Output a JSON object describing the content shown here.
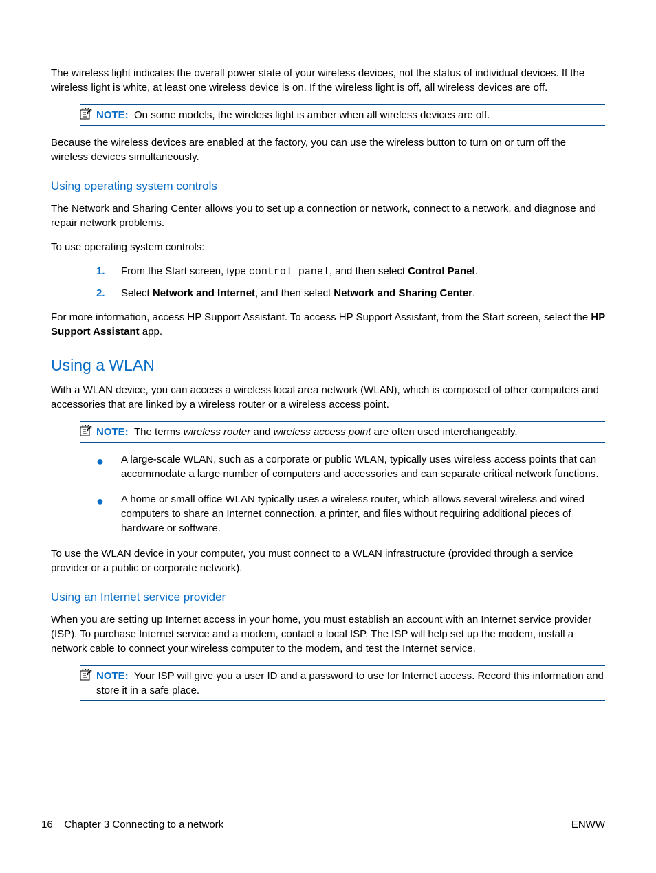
{
  "intro": {
    "para1": "The wireless light indicates the overall power state of your wireless devices, not the status of individual devices. If the wireless light is white, at least one wireless device is on. If the wireless light is off, all wireless devices are off."
  },
  "notes": {
    "label": "NOTE:",
    "note1": "On some models, the wireless light is amber when all wireless devices are off.",
    "note2_pre": "The terms ",
    "note2_i1": "wireless router",
    "note2_mid": " and ",
    "note2_i2": "wireless access point",
    "note2_post": " are often used interchangeably.",
    "note3": "Your ISP will give you a user ID and a password to use for Internet access. Record this information and store it in a safe place."
  },
  "after_note1": "Because the wireless devices are enabled at the factory, you can use the wireless button to turn on or turn off the wireless devices simultaneously.",
  "h3_os": "Using operating system controls",
  "os": {
    "p1": "The Network and Sharing Center allows you to set up a connection or network, connect to a network, and diagnose and repair network problems.",
    "p2": "To use operating system controls:",
    "step1_pre": "From the Start screen, type ",
    "step1_mono": "control panel",
    "step1_mid": ", and then select ",
    "step1_bold": "Control Panel",
    "step1_post": ".",
    "step2_pre": "Select ",
    "step2_b1": "Network and Internet",
    "step2_mid": ", and then select ",
    "step2_b2": "Network and Sharing Center",
    "step2_post": ".",
    "p3_pre": "For more information, access HP Support Assistant. To access HP Support Assistant, from the Start screen, select the ",
    "p3_bold": "HP Support Assistant",
    "p3_post": " app."
  },
  "h2_wlan": "Using a WLAN",
  "wlan": {
    "p1": "With a WLAN device, you can access a wireless local area network (WLAN), which is composed of other computers and accessories that are linked by a wireless router or a wireless access point.",
    "b1": "A large-scale WLAN, such as a corporate or public WLAN, typically uses wireless access points that can accommodate a large number of computers and accessories and can separate critical network functions.",
    "b2": "A home or small office WLAN typically uses a wireless router, which allows several wireless and wired computers to share an Internet connection, a printer, and files without requiring additional pieces of hardware or software.",
    "p2": "To use the WLAN device in your computer, you must connect to a WLAN infrastructure (provided through a service provider or a public or corporate network)."
  },
  "h3_isp": "Using an Internet service provider",
  "isp": {
    "p1": "When you are setting up Internet access in your home, you must establish an account with an Internet service provider (ISP). To purchase Internet service and a modem, contact a local ISP. The ISP will help set up the modem, install a network cable to connect your wireless computer to the modem, and test the Internet service."
  },
  "steps_nums": {
    "n1": "1.",
    "n2": "2."
  },
  "footer": {
    "page": "16",
    "chapter": "Chapter 3   Connecting to a network",
    "right": "ENWW"
  }
}
